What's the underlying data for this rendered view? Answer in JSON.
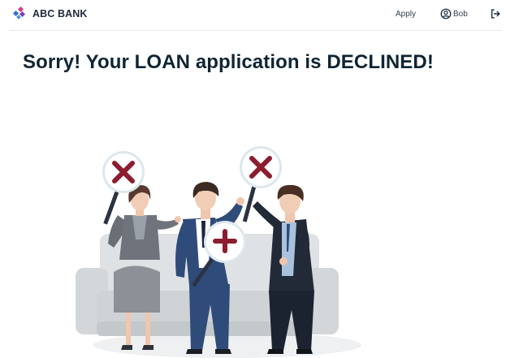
{
  "brand": {
    "name": "ABC BANK",
    "logo_icon": "diamond-cluster-logo",
    "colors": {
      "blue": "#2f6fd8",
      "pink": "#d63a8c",
      "purple": "#7a3fbf"
    }
  },
  "nav": {
    "apply_label": "Apply",
    "user_name": "Bob",
    "user_icon": "user-circle-icon",
    "logout_icon": "logout-icon"
  },
  "main": {
    "title": "Sorry! Your LOAN application is DECLINED!"
  },
  "illustration": {
    "subject": "declined-illustration",
    "sign_icon": "red-x-sign",
    "colors": {
      "cross": "#8c1d2e",
      "sofa": "#d5d9dc",
      "suit": "#243751"
    }
  }
}
